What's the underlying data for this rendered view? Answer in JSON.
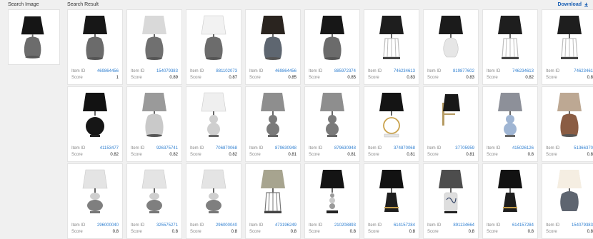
{
  "header": {
    "search_image_label": "Search Image",
    "search_result_label": "Search Result",
    "download_label": "Download"
  },
  "field_labels": {
    "item_id": "Item ID",
    "score": "Score"
  },
  "results": [
    [
      {
        "item_id": "469864456",
        "score": "1",
        "style": "dark-gray"
      },
      {
        "item_id": "154079383",
        "score": "0.89",
        "style": "light-gray"
      },
      {
        "item_id": "881102073",
        "score": "0.87",
        "style": "white-gray"
      },
      {
        "item_id": "469864456",
        "score": "0.85",
        "style": "dark-brown"
      },
      {
        "item_id": "885972374",
        "score": "0.85",
        "style": "dark-gray"
      },
      {
        "item_id": "746234613",
        "score": "0.83",
        "style": "cage-dark"
      },
      {
        "item_id": "819877602",
        "score": "0.83",
        "style": "ceramic-white"
      },
      {
        "item_id": "746234613",
        "score": "0.82",
        "style": "cage-dark"
      },
      {
        "item_id": "74623461",
        "score": "0.8",
        "style": "cage-dark"
      }
    ],
    [
      {
        "item_id": "41153477",
        "score": "0.82",
        "style": "black-ball"
      },
      {
        "item_id": "926375741",
        "score": "0.82",
        "style": "gray-light"
      },
      {
        "item_id": "706870068",
        "score": "0.82",
        "style": "white-gourd"
      },
      {
        "item_id": "879630948",
        "score": "0.81",
        "style": "gray-gourd"
      },
      {
        "item_id": "879630948",
        "score": "0.81",
        "style": "gray-gourd"
      },
      {
        "item_id": "374870068",
        "score": "0.81",
        "style": "ring-black"
      },
      {
        "item_id": "37705959",
        "score": "0.81",
        "style": "sconce"
      },
      {
        "item_id": "415026126",
        "score": "0.8",
        "style": "blue-gourd"
      },
      {
        "item_id": "51366370",
        "score": "0.8",
        "style": "amber"
      }
    ],
    [
      {
        "item_id": "296000040",
        "score": "0.8",
        "style": "stack-white"
      },
      {
        "item_id": "325575271",
        "score": "0.8",
        "style": "stack-white"
      },
      {
        "item_id": "296000040",
        "score": "0.8",
        "style": "stack-white"
      },
      {
        "item_id": "473196249",
        "score": "0.8",
        "style": "wire"
      },
      {
        "item_id": "210208893",
        "score": "0.8",
        "style": "crystal"
      },
      {
        "item_id": "614157284",
        "score": "0.8",
        "style": "cone-black"
      },
      {
        "item_id": "891134664",
        "score": "0.8",
        "style": "floral"
      },
      {
        "item_id": "614157284",
        "score": "0.8",
        "style": "cone-black"
      },
      {
        "item_id": "154079383",
        "score": "0.8",
        "style": "glow"
      }
    ]
  ],
  "colors": {
    "id_link": "#2f7fd0",
    "download": "#1a5fb4",
    "background": "#f0f0f0"
  },
  "icons": {
    "download": "download-icon"
  }
}
